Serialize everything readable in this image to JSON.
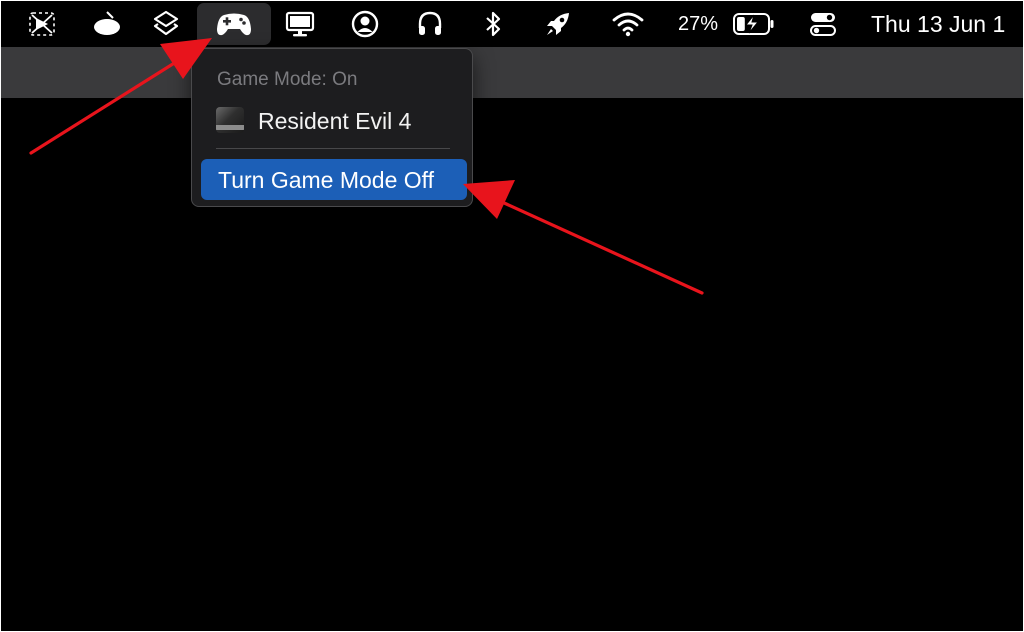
{
  "menubar": {
    "icons": [
      "screen-capture-icon",
      "ufo-icon",
      "shortcuts-icon",
      "game-controller-icon",
      "display-icon",
      "user-icon",
      "headphones-icon",
      "bluetooth-icon",
      "rocket-icon",
      "wifi-icon",
      "battery-charging-icon",
      "control-center-icon"
    ],
    "battery_percent": "27%",
    "battery_level": 0.27,
    "clock": "Thu 13 Jun  1"
  },
  "game_mode_menu": {
    "header": "Game Mode: On",
    "game_name": "Resident Evil 4",
    "action_label": "Turn Game Mode Off"
  },
  "colors": {
    "menu_highlight": "#1c5fb7",
    "annotation_arrow": "#e8141c",
    "menu_background": "#1d1d1f"
  }
}
